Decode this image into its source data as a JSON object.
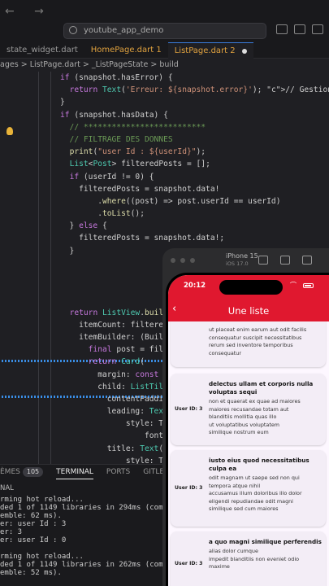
{
  "window": {
    "search_text": "youtube_app_demo"
  },
  "tabs": [
    {
      "label": "state_widget.dart",
      "state": "normal"
    },
    {
      "label": "HomePage.dart 1",
      "state": "modified"
    },
    {
      "label": "ListPage.dart 2",
      "state": "active"
    }
  ],
  "breadcrumb": {
    "folder": "ages",
    "sep1": ">",
    "file": "ListPage.dart",
    "sep2": ">",
    "class": "_ListPageState",
    "sep3": ">",
    "method": "build"
  },
  "code_lines": [
    "if (snapshot.hasError) {",
    "  return Text('Erreur: ${snapshot.error}'); // Gestion des erreurs",
    "}",
    "if (snapshot.hasData) {",
    "  // **************************",
    "  // FILTRAGE DES DONNES",
    "  print(\"user Id : ${userId}\");",
    "  List<Post> filteredPosts = [];",
    "  if (userId != 0) {",
    "    filteredPosts = snapshot.data!",
    "        .where((post) => post.userId == userId)",
    "        .toList();",
    "  } else {",
    "    filteredPosts = snapshot.data!;",
    "  }",
    "",
    "",
    "",
    "",
    "  return ListView.builder(",
    "    itemCount: filteredPost",
    "    itemBuilder: (BuildCon",
    "      final post = filtere",
    "      return Card(",
    "        margin: const Edge",
    "        child: ListTile(",
    "          contentPadding:",
    "          leading: Text('U",
    "              style: TextS",
    "                  fontSize",
    "          title: Text(pos",
    "              style: TextS",
    "                  fontSiz",
    "          subtitle: Text(p",
    "        ), // ListTile",
    "      ); // Card",
    "    },",
    "  ); // ListView.builder",
    "} else {",
    "  return Text("
  ],
  "panel": {
    "tabs": [
      {
        "label": "ÈMES",
        "badge": "105"
      },
      {
        "label": "TERMINAL",
        "badge": ""
      },
      {
        "label": "PORTS",
        "badge": ""
      },
      {
        "label": "GITLENS",
        "badge": ""
      }
    ],
    "title": "NAL",
    "lines": [
      "rming hot reload...",
      "ded 1 of 1149 libraries in 294ms (compile: 63",
      "emble: 62 ms).",
      "er: user Id : 3",
      "er: 3",
      "er: user Id : 0",
      "",
      "rming hot reload...",
      "ded 1 of 1149 libraries in 262ms (compile: 61",
      "emble: 52 ms)."
    ]
  },
  "simulator": {
    "device_name": "iPhone 15",
    "os": "iOS 17.0",
    "status_time": "20:12",
    "app_title": "Une liste",
    "back_icon": "back-arrow-icon"
  },
  "posts": [
    {
      "user": "",
      "title": "",
      "body": "ut placeat enim earum aut odit facilis\nconsequatur suscipit necessitatibus\nrerum sed inventore temporibus\nconsequatur"
    },
    {
      "user": "User ID: 3",
      "title": "delectus ullam et corporis nulla voluptas sequi",
      "body": "non et quaerat ex quae ad maiores\nmaiores recusandae totam aut\nblanditiis mollitia quas illo\nut voluptatibus voluptatem\nsimilique nostrum eum"
    },
    {
      "user": "User ID: 3",
      "title": "iusto eius quod necessitatibus culpa ea",
      "body": "odit magnam ut saepe sed non qui\ntempora atque nihil\naccusamus illum doloribus illo dolor\neligendi repudiandae odit magni\nsimilique sed cum maiores"
    },
    {
      "user": "User ID: 3",
      "title": "a quo magni similique perferendis",
      "body": "alias dolor cumque\nimpedit blanditiis non eveniet odio\nmaxime"
    }
  ],
  "colors": {
    "app_bar": "#e0182f",
    "card_bg": "#f3edf6",
    "screen_bg": "#fdf7ff"
  }
}
